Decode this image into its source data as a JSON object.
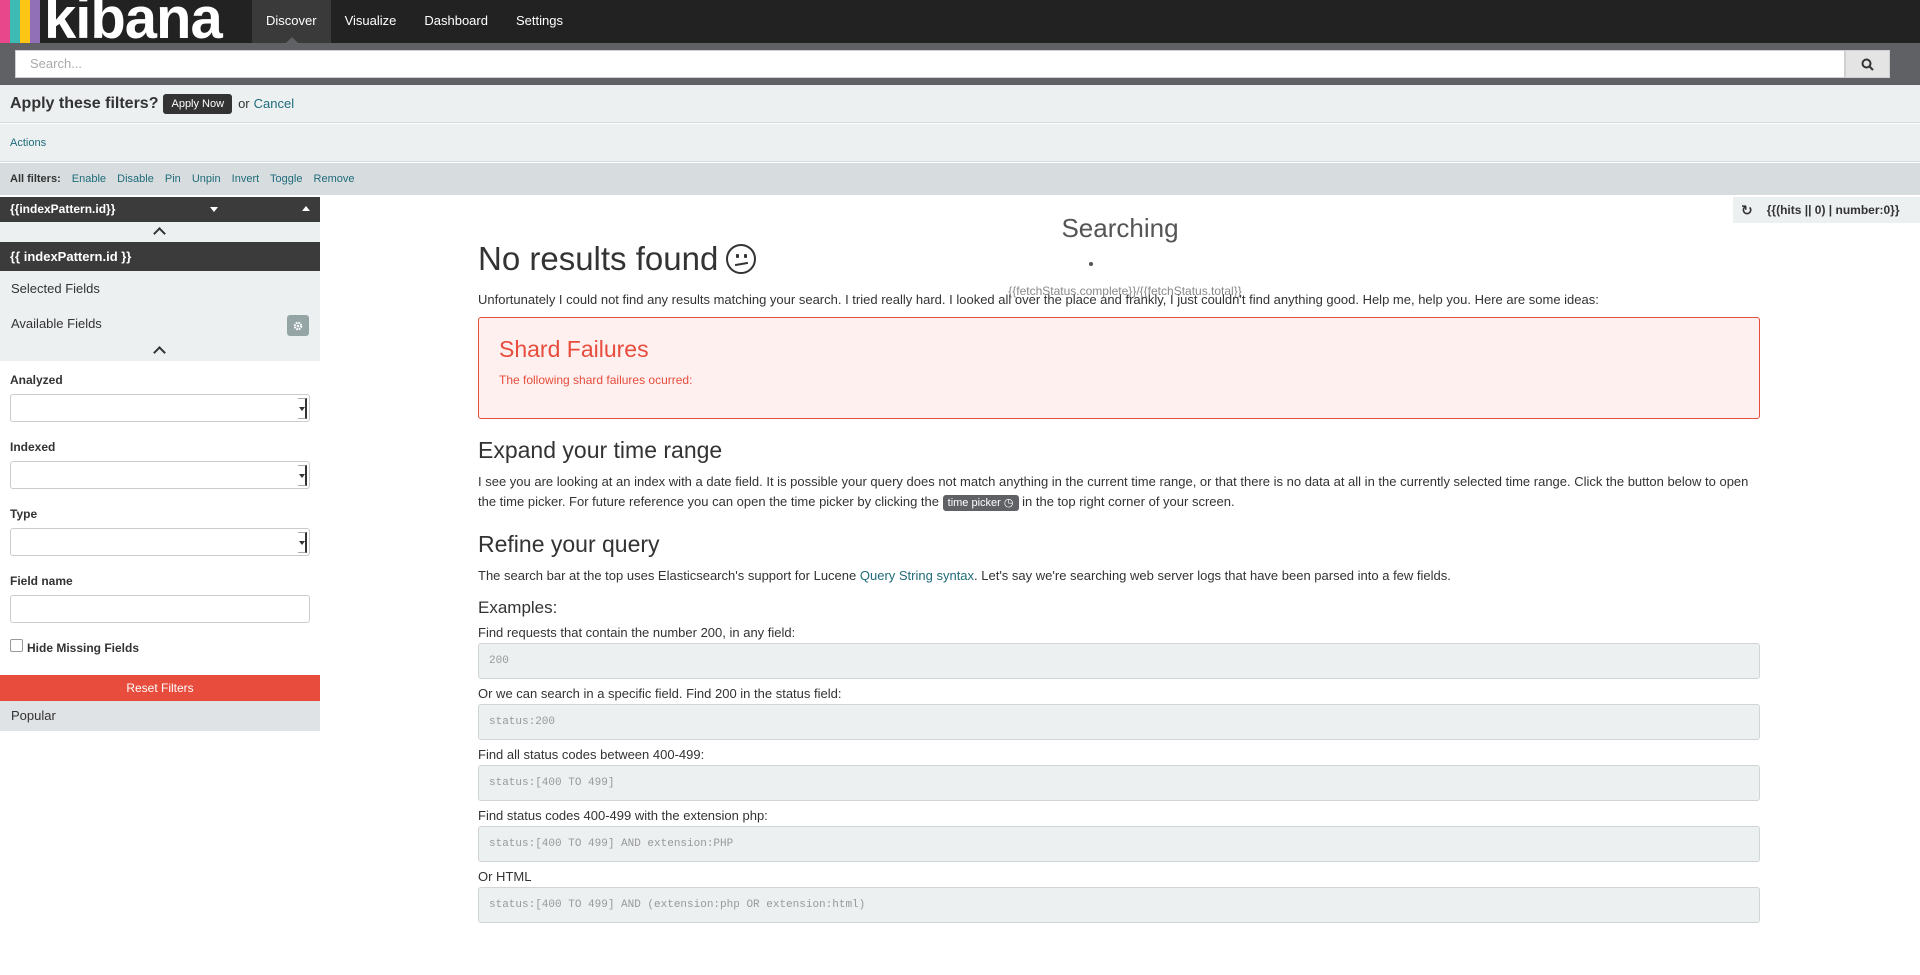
{
  "brand": {
    "name": "kibana",
    "stripe_colors": [
      "#e8488b",
      "#3cbab3",
      "#fec514",
      "#9170b8"
    ]
  },
  "nav": {
    "items": [
      {
        "label": "Discover",
        "active": true
      },
      {
        "label": "Visualize",
        "active": false
      },
      {
        "label": "Dashboard",
        "active": false
      },
      {
        "label": "Settings",
        "active": false
      }
    ]
  },
  "search": {
    "placeholder": "Search..."
  },
  "apply_filters": {
    "question": "Apply these filters?",
    "apply_label": "Apply Now",
    "or_text": "or",
    "cancel_label": "Cancel"
  },
  "actions": {
    "label": "Actions"
  },
  "all_filters": {
    "label": "All filters:",
    "links": [
      "Enable",
      "Disable",
      "Pin",
      "Unpin",
      "Invert",
      "Toggle",
      "Remove"
    ]
  },
  "sidebar": {
    "index_pattern_select": "{{indexPattern.id}}",
    "index_pattern_title": "{{ indexPattern.id }}",
    "selected_fields": "Selected Fields",
    "available_fields": "Available Fields",
    "filters": {
      "analyzed_label": "Analyzed",
      "indexed_label": "Indexed",
      "type_label": "Type",
      "field_name_label": "Field name",
      "hide_missing_label": "Hide Missing Fields",
      "reset_label": "Reset Filters"
    },
    "popular": "Popular"
  },
  "hits": {
    "text": "{{(hits || 0) | number:0}}"
  },
  "status": {
    "searching": "Searching",
    "fetch": "{{fetchStatus.complete}}/{{fetchStatus.total}}"
  },
  "main": {
    "title": "No results found",
    "intro": "Unfortunately I could not find any results matching your search. I tried really hard. I looked all over the place and frankly, I just couldn't find anything good. Help me, help you. Here are some ideas:",
    "shard": {
      "title": "Shard Failures",
      "text": "The following shard failures ocurred:"
    },
    "expand": {
      "title": "Expand your time range",
      "text_before": "I see you are looking at an index with a date field. It is possible your query does not match anything in the current time range, or that there is no data at all in the currently selected time range. Click the button below to open the time picker. For future reference you can open the time picker by clicking the",
      "time_picker": "time picker",
      "text_after": "in the top right corner of your screen."
    },
    "refine": {
      "title": "Refine your query",
      "text_before": "The search bar at the top uses Elasticsearch's support for Lucene",
      "link": "Query String syntax",
      "text_after": ". Let's say we're searching web server logs that have been parsed into a few fields."
    },
    "examples_title": "Examples:",
    "examples": [
      {
        "label": "Find requests that contain the number 200, in any field:",
        "code": "200"
      },
      {
        "label": "Or we can search in a specific field. Find 200 in the status field:",
        "code": "status:200"
      },
      {
        "label": "Find all status codes between 400-499:",
        "code": "status:[400 TO 499]"
      },
      {
        "label": "Find status codes 400-499 with the extension php:",
        "code": "status:[400 TO 499] AND extension:PHP"
      },
      {
        "label": "Or HTML",
        "code": "status:[400 TO 499] AND (extension:php OR extension:html)"
      }
    ]
  }
}
